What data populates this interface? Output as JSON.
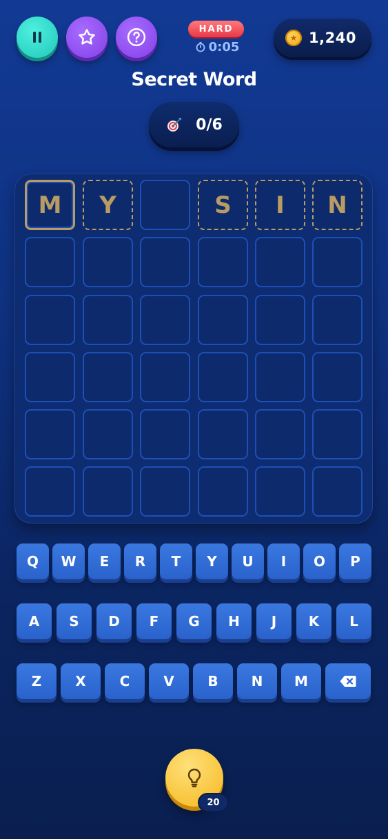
{
  "header": {
    "difficulty": "HARD",
    "timer": "0:05",
    "coins": "1,240"
  },
  "title": "Secret Word",
  "attempts": "0/6",
  "board": {
    "rows": [
      [
        "M",
        "Y",
        "",
        "S",
        "I",
        "N"
      ],
      [
        "",
        "",
        "",
        "",
        "",
        ""
      ],
      [
        "",
        "",
        "",
        "",
        "",
        ""
      ],
      [
        "",
        "",
        "",
        "",
        "",
        ""
      ],
      [
        "",
        "",
        "",
        "",
        "",
        ""
      ],
      [
        "",
        "",
        "",
        "",
        "",
        ""
      ]
    ],
    "hint_tiles": [
      [
        0,
        0
      ],
      [
        0,
        1
      ],
      [
        0,
        3
      ],
      [
        0,
        4
      ],
      [
        0,
        5
      ]
    ],
    "active_tile": [
      0,
      0
    ]
  },
  "keyboard": {
    "row1": [
      "Q",
      "W",
      "E",
      "R",
      "T",
      "Y",
      "U",
      "I",
      "O",
      "P"
    ],
    "row2": [
      "A",
      "S",
      "D",
      "F",
      "G",
      "H",
      "J",
      "K",
      "L"
    ],
    "row3": [
      "Z",
      "X",
      "C",
      "V",
      "B",
      "N",
      "M"
    ],
    "backspace_icon": "backspace-icon"
  },
  "hint_button": {
    "icon": "lightbulb-icon",
    "cost": "20"
  },
  "colors": {
    "accent_teal": "#2bd6c6",
    "accent_purple": "#8a4cf0",
    "hint_gold": "#b89c63",
    "key_blue": "#2f69d4",
    "badge_red": "#f04858"
  }
}
